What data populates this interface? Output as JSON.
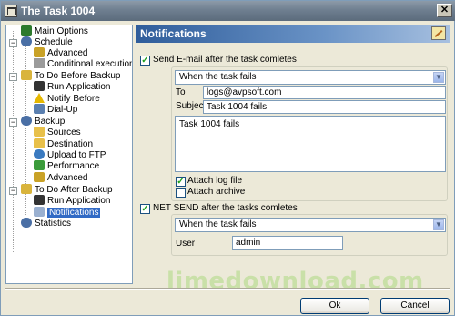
{
  "window": {
    "title": "The Task 1004"
  },
  "tree": {
    "items": [
      {
        "label": "Main Options",
        "color": "#2c7a2c"
      },
      {
        "label": "Schedule",
        "color": "#4a6fa5"
      },
      {
        "label": "Advanced",
        "color": "#c9a227"
      },
      {
        "label": "Conditional execution",
        "color": "#9b9b9b"
      },
      {
        "label": "To Do Before Backup",
        "color": "#d9b43c"
      },
      {
        "label": "Run Application",
        "color": "#333333"
      },
      {
        "label": "Notify Before",
        "color": "#e6b800"
      },
      {
        "label": "Dial-Up",
        "color": "#5a7fb0"
      },
      {
        "label": "Backup",
        "color": "#4a6fa5"
      },
      {
        "label": "Sources",
        "color": "#e8c04a"
      },
      {
        "label": "Destination",
        "color": "#e8c04a"
      },
      {
        "label": "Upload to FTP",
        "color": "#3a7ac0"
      },
      {
        "label": "Performance",
        "color": "#3b9b3b"
      },
      {
        "label": "Advanced",
        "color": "#c9a227"
      },
      {
        "label": "To Do After Backup",
        "color": "#d9b43c"
      },
      {
        "label": "Run Application",
        "color": "#333333"
      },
      {
        "label": "Notifications",
        "color": "#9ab0d0"
      },
      {
        "label": "Statistics",
        "color": "#4a6fa5"
      }
    ]
  },
  "header": {
    "title": "Notifications",
    "icon": "edit-icon"
  },
  "email": {
    "checkbox_label": "Send E-mail after the task comletes",
    "checked": true,
    "condition": "When the task fails",
    "to_label": "To",
    "to_value": "logs@avpsoft.com",
    "subject_label": "Subject",
    "subject_value": "Task 1004 fails",
    "body": "Task 1004 fails",
    "attach_log_label": "Attach log file",
    "attach_log_checked": true,
    "attach_archive_label": "Attach archive",
    "attach_archive_checked": false
  },
  "netsend": {
    "checkbox_label": "NET SEND after the tasks comletes",
    "checked": true,
    "condition": "When the task fails",
    "user_label": "User",
    "user_value": "admin"
  },
  "buttons": {
    "ok": "Ok",
    "cancel": "Cancel"
  },
  "watermark": "limedownload.com"
}
